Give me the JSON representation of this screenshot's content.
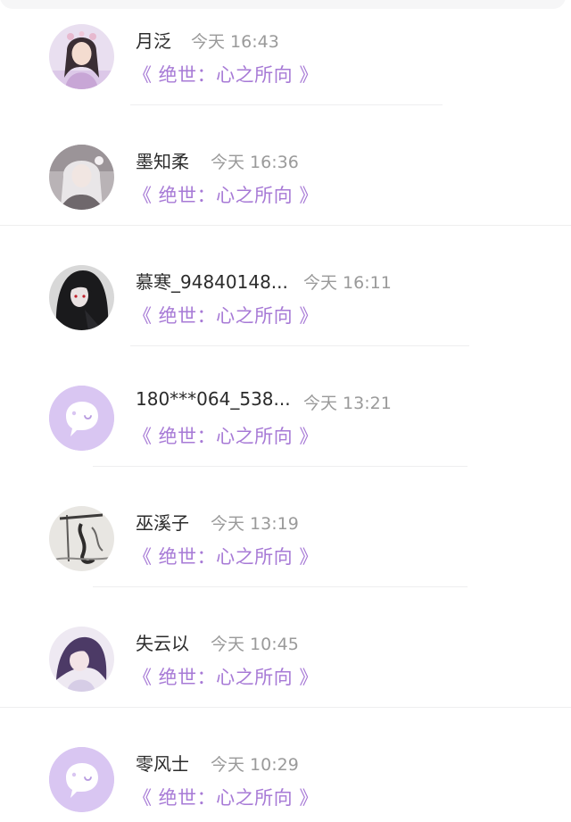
{
  "comments": [
    {
      "name": "月泛",
      "time": "今天 16:43",
      "book": "《 绝世：心之所向 》",
      "avatar": "girl-pink-avatar"
    },
    {
      "name": "墨知柔",
      "time": "今天 16:36",
      "book": "《 绝世：心之所向 》",
      "avatar": "girl-silver-avatar"
    },
    {
      "name": "慕寒_94840148...",
      "time": "今天 16:11",
      "book": "《 绝世：心之所向 》",
      "avatar": "dark-hair-avatar"
    },
    {
      "name": "180***064_538...",
      "time": "今天 13:21",
      "book": "《 绝世：心之所向 》",
      "avatar": "default-chat-avatar"
    },
    {
      "name": "巫溪子",
      "time": "今天 13:19",
      "book": "《 绝世：心之所向 》",
      "avatar": "ink-painting-avatar"
    },
    {
      "name": "失云以",
      "time": "今天 10:45",
      "book": "《 绝世：心之所向 》",
      "avatar": "girl-purple-avatar"
    },
    {
      "name": "零风士",
      "time": "今天 10:29",
      "book": "《 绝世：心之所向 》",
      "avatar": "default-chat-avatar"
    }
  ],
  "colors": {
    "accent": "#a77ad6",
    "default_avatar_bg": "#d9c6f2",
    "name_text": "#2b2b2b",
    "time_text": "#9a9a9a"
  }
}
